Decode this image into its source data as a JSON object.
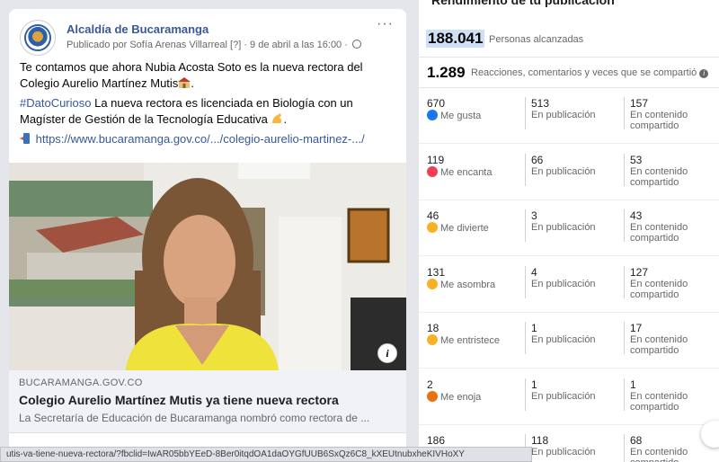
{
  "post": {
    "page_name": "Alcaldía de Bucaramanga",
    "meta": "Publicado por Sofía Arenas Villarreal",
    "meta_help": "[?]",
    "meta_date": "· 9 de abril a las 16:00 ·",
    "more": "···",
    "text1": "Te contamos que ahora Nubia Acosta Soto es la nueva rectora del Colegio Aurelio Martínez Mutis",
    "hashtag": "#DatoCurioso",
    "text2": " La nueva rectora es licenciada en Biología con un Magíster de Gestión de la Tecnología Educativa",
    "link": "https://www.bucaramanga.gov.co/.../colegio-aurelio-martinez-.../",
    "card_domain": "BUCARAMANGA.GOV.CO",
    "card_title": "Colegio Aurelio Martínez Mutis ya tiene nueva rectora",
    "card_desc": "La Secretaría de Educación de Bucaramanga nombró como rectora de ...",
    "info": "i"
  },
  "panel": {
    "title": "Rendimiento de tu publicación",
    "reach_value": "188.041",
    "reach_label": "Personas alcanzadas",
    "reactions_value": "1.289",
    "reactions_label": "Reacciones, comentarios y veces que se compartió",
    "in_post": "En publicación",
    "in_shared_1": "En contenido",
    "in_shared_2": "compartido",
    "rows": [
      {
        "total": "670",
        "label": "Me gusta",
        "post": "513",
        "shared": "157",
        "color": "#1877f2"
      },
      {
        "total": "119",
        "label": "Me encanta",
        "post": "66",
        "shared": "53",
        "color": "#f33e58"
      },
      {
        "total": "46",
        "label": "Me divierte",
        "post": "3",
        "shared": "43",
        "color": "#f7b125"
      },
      {
        "total": "131",
        "label": "Me asombra",
        "post": "4",
        "shared": "127",
        "color": "#f7b125"
      },
      {
        "total": "18",
        "label": "Me entristece",
        "post": "1",
        "shared": "17",
        "color": "#f7b125"
      },
      {
        "total": "2",
        "label": "Me enoja",
        "post": "1",
        "shared": "1",
        "color": "#e9710f"
      },
      {
        "total": "186",
        "label": "",
        "post": "118",
        "shared": "68",
        "color": "#ffffff"
      }
    ]
  },
  "status_url": "utis-va-tiene-nueva-rectora/?fbclid=IwAR05bbYEeD-8Ber0itqdOA1daOYGfUUB6SxQz6C8_kXEUtnubxheKIVHoXY"
}
